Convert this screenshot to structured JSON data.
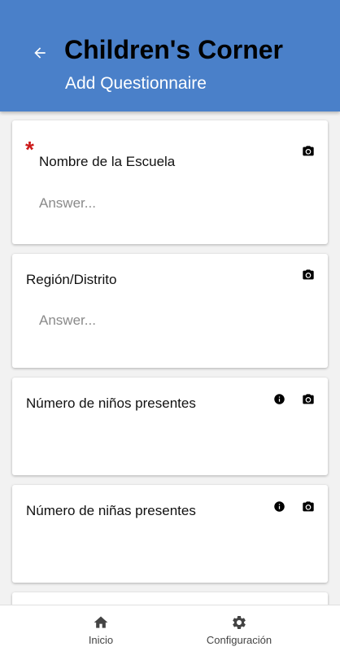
{
  "header": {
    "title": "Children's Corner",
    "subtitle": "Add Questionnaire",
    "background_color": "#4a80c9",
    "back_icon": "arrow-left-icon"
  },
  "questions": [
    {
      "label": "Nombre de la Escuela",
      "required": true,
      "required_mark": "*",
      "placeholder": "Answer...",
      "has_info": false,
      "has_camera": true
    },
    {
      "label": "Región/Distrito",
      "required": false,
      "placeholder": "Answer...",
      "has_info": false,
      "has_camera": true
    },
    {
      "label": "Número de niños presentes",
      "required": false,
      "has_info": true,
      "has_camera": true
    },
    {
      "label": "Número de niñas presentes",
      "required": false,
      "has_info": true,
      "has_camera": true
    }
  ],
  "bottom_nav": {
    "items": [
      {
        "label": "Inicio",
        "icon": "home-icon"
      },
      {
        "label": "Configuración",
        "icon": "gear-icon"
      }
    ]
  },
  "colors": {
    "required": "#cc1a1a",
    "page_background": "#f2f2f2"
  }
}
